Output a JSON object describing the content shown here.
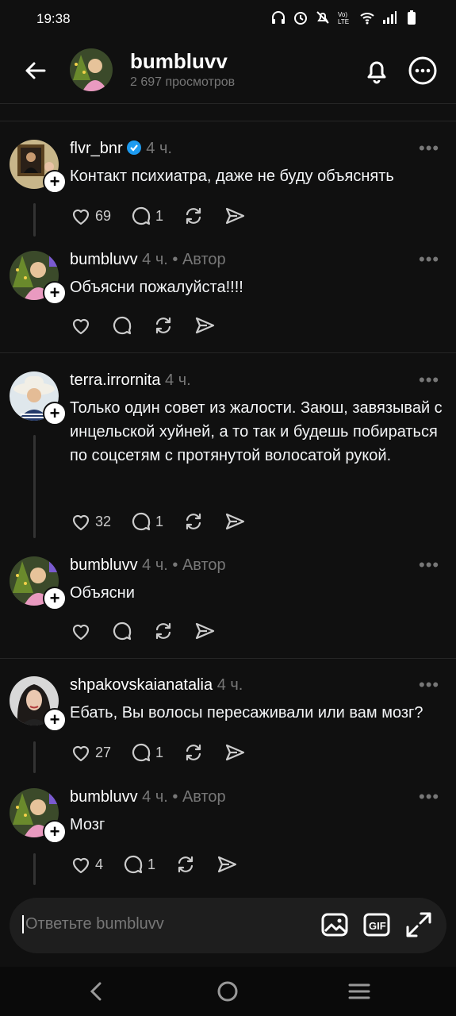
{
  "status": {
    "time": "19:38"
  },
  "header": {
    "name": "bumbluvv",
    "views": "2 697 просмотров"
  },
  "posts": [
    {
      "user": "flvr_bnr",
      "time": "4 ч.",
      "author_tag": "",
      "verified": true,
      "text": "Контакт психиатра, даже не буду объяснять",
      "likes": "69",
      "replies": "1"
    },
    {
      "user": "bumbluvv",
      "time": "4 ч.",
      "author_tag": "• Автор",
      "verified": false,
      "text": "Объясни пожалуйста!!!!",
      "likes": "",
      "replies": ""
    },
    {
      "user": "terra.irrornita",
      "time": "4 ч.",
      "author_tag": "",
      "verified": false,
      "text": "Только один совет из жалости. Заюш, завязывай с инцельской хуйней, а то так и будешь побираться по соцсетям с протянутой волосатой рукой.",
      "likes": "32",
      "replies": "1"
    },
    {
      "user": "bumbluvv",
      "time": "4 ч.",
      "author_tag": "• Автор",
      "verified": false,
      "text": "Объясни",
      "likes": "",
      "replies": ""
    },
    {
      "user": "shpakovskaianatalia",
      "time": "4 ч.",
      "author_tag": "",
      "verified": false,
      "text": "Ебать, Вы волосы пересаживали или вам мозг?",
      "likes": "27",
      "replies": "1"
    },
    {
      "user": "bumbluvv",
      "time": "4 ч.",
      "author_tag": "• Автор",
      "verified": false,
      "text": "Мозг",
      "likes": "4",
      "replies": "1"
    }
  ],
  "reply": {
    "placeholder": "Ответьте bumbluvv"
  },
  "icons": [
    "back-arrow-icon",
    "bell-icon",
    "more-icon",
    "heart-icon",
    "comment-icon",
    "repost-icon",
    "share-icon",
    "image-icon",
    "gif-icon",
    "expand-icon"
  ]
}
